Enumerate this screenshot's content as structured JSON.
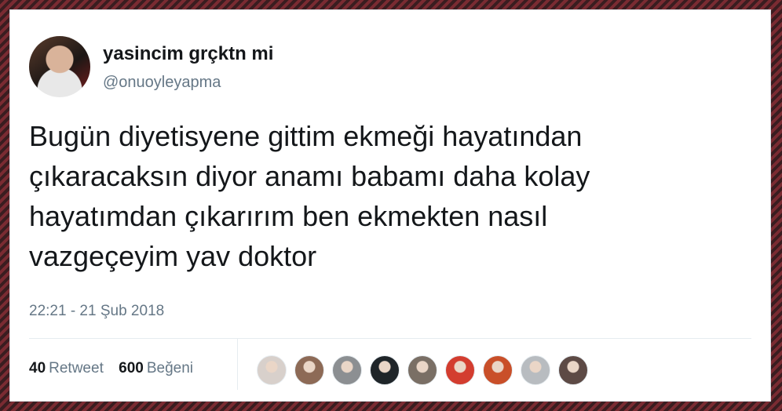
{
  "tweet": {
    "display_name": "yasincim grçktn mi",
    "handle": "@onuoyleyapma",
    "text": "Bugün diyetisyene gittim ekmeği hayatından\nçıkaracaksın diyor anamı babamı daha kolay\nhayatımdan çıkarırım ben ekmekten nasıl\nvazgeçeyim yav doktor",
    "timestamp": "22:21 - 21 Şub 2018"
  },
  "stats": {
    "retweets": {
      "count": "40",
      "label": "Retweet"
    },
    "likes": {
      "count": "600",
      "label": "Beğeni"
    }
  },
  "colors": {
    "text": "#14171a",
    "secondary_text": "#657786",
    "divider": "#e6ecf0",
    "background_stripe_dark": "#3a1d20",
    "background_stripe_red": "#7a2b32"
  },
  "liker_avatars": [
    {
      "icon": "user-avatar",
      "color": "#d8d0cb"
    },
    {
      "icon": "user-avatar",
      "color": "#8d6a56"
    },
    {
      "icon": "user-avatar",
      "color": "#8c8f92"
    },
    {
      "icon": "user-avatar",
      "color": "#1f2529"
    },
    {
      "icon": "user-avatar",
      "color": "#7a6f65"
    },
    {
      "icon": "user-avatar",
      "color": "#d33d2f"
    },
    {
      "icon": "user-avatar",
      "color": "#c94f29"
    },
    {
      "icon": "user-avatar",
      "color": "#b8bcc0"
    },
    {
      "icon": "user-avatar",
      "color": "#5d4a45"
    }
  ]
}
